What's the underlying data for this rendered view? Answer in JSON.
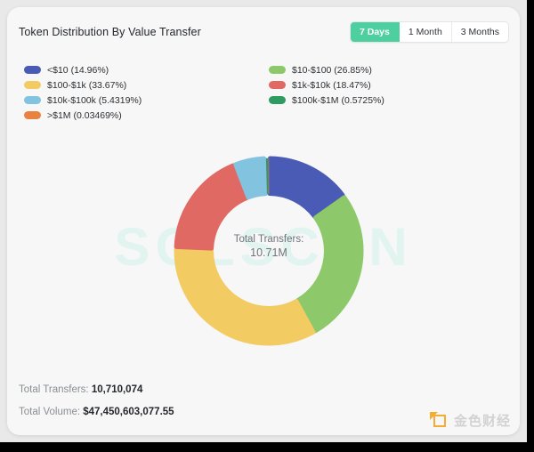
{
  "header": {
    "title": "Token Distribution By Value Transfer",
    "ranges": [
      {
        "label": "7 Days",
        "active": true
      },
      {
        "label": "1 Month",
        "active": false
      },
      {
        "label": "3 Months",
        "active": false
      }
    ]
  },
  "legend": {
    "left": [
      {
        "label": "<$10 (14.96%)",
        "color": "#4a5bb5"
      },
      {
        "label": "$100-$1k (33.67%)",
        "color": "#f3cb63"
      },
      {
        "label": "$10k-$100k (5.4319%)",
        "color": "#82c4e0"
      },
      {
        "label": ">$1M (0.03469%)",
        "color": "#e9813f"
      }
    ],
    "right": [
      {
        "label": "$10-$100 (26.85%)",
        "color": "#8dc96a"
      },
      {
        "label": "$1k-$10k (18.47%)",
        "color": "#e06a63"
      },
      {
        "label": "$100k-$1M (0.5725%)",
        "color": "#2e9b63"
      }
    ]
  },
  "chart_data": {
    "type": "pie",
    "title": "Token Distribution By Value Transfer",
    "subtype": "donut",
    "watermark": "SOLSCAN",
    "center_title": "Total Transfers:",
    "center_value": "10.71M",
    "unit": "percent",
    "legend_position": "top",
    "categories": [
      "<$10",
      "$10-$100",
      "$100-$1k",
      "$1k-$10k",
      "$10k-$100k",
      "$100k-$1M",
      ">$1M"
    ],
    "values": [
      14.96,
      26.85,
      33.67,
      18.47,
      5.4319,
      0.5725,
      0.03469
    ],
    "labels": [
      "<$10 (14.96%)",
      "$10-$100 (26.85%)",
      "$100-$1k (33.67%)",
      "$1k-$10k (18.47%)",
      "$10k-$100k (5.4319%)",
      "$100k-$1M (0.5725%)",
      ">$1M (0.03469%)"
    ],
    "colors": [
      "#4a5bb5",
      "#8dc96a",
      "#f3cb63",
      "#e06a63",
      "#82c4e0",
      "#2e9b63",
      "#e9813f"
    ],
    "start_angle_deg": 0,
    "direction": "clockwise",
    "inner_radius_ratio": 0.62
  },
  "stats": [
    {
      "label": "Total Transfers: ",
      "value": "10,710,074"
    },
    {
      "label": "Total Volume: ",
      "value": "$47,450,603,077.55"
    }
  ],
  "brand": {
    "text": "金色财经"
  }
}
